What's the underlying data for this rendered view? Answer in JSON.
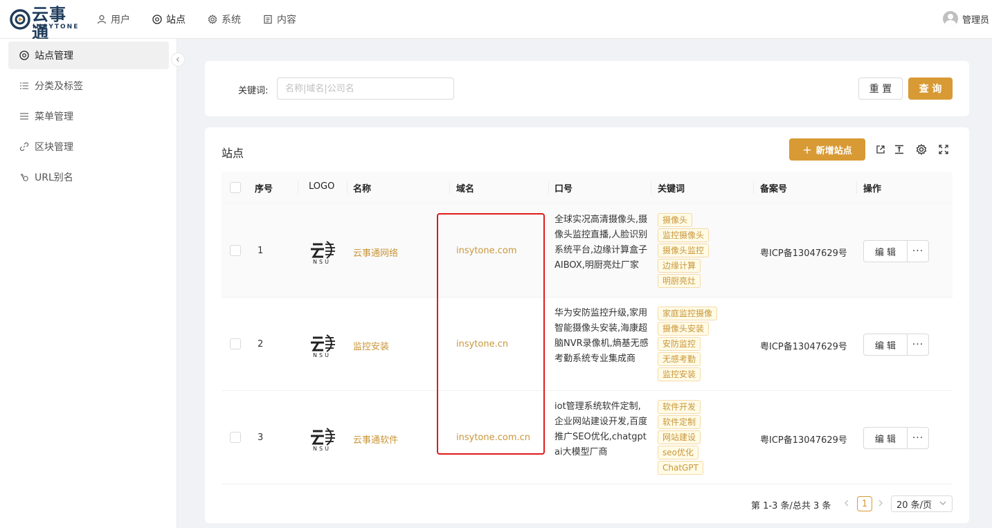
{
  "app": {
    "logo_cn": "云事通",
    "logo_en": "INSYTONE"
  },
  "topnav": [
    {
      "label": "用户",
      "icon": "user-icon"
    },
    {
      "label": "站点",
      "icon": "chrome-icon"
    },
    {
      "label": "系统",
      "icon": "gear-icon"
    },
    {
      "label": "内容",
      "icon": "document-icon"
    }
  ],
  "user": {
    "name": "管理员"
  },
  "sidebar": {
    "items": [
      {
        "label": "站点管理",
        "icon": "chrome-icon"
      },
      {
        "label": "分类及标签",
        "icon": "list-icon"
      },
      {
        "label": "菜单管理",
        "icon": "menu-icon"
      },
      {
        "label": "区块管理",
        "icon": "link-icon"
      },
      {
        "label": "URL别名",
        "icon": "url-icon"
      }
    ]
  },
  "search": {
    "label": "关键词:",
    "placeholder": "名称|域名|公司名",
    "value": "",
    "reset_label": "重 置",
    "query_label": "查 询"
  },
  "table": {
    "title": "站点",
    "add_label": "新增站点",
    "columns": [
      "序号",
      "LOGO",
      "名称",
      "域名",
      "口号",
      "关键词",
      "备案号",
      "操作"
    ],
    "edit_label": "编 辑",
    "more_label": "···",
    "rows": [
      {
        "seq": "1",
        "name": "云事通网络",
        "domain": "insytone.com",
        "slogan": "全球实况高清摄像头,摄像头监控直播,人脸识别系统平台,边缘计算盒子AIBOX,明厨亮灶厂家",
        "tags": [
          "摄像头",
          "监控摄像头",
          "摄像头监控",
          "边缘计算",
          "明厨亮灶"
        ],
        "icp": "粤ICP备13047629号"
      },
      {
        "seq": "2",
        "name": "监控安装",
        "domain": "insytone.cn",
        "slogan": "华为安防监控升级,家用智能摄像头安装,海康超脑NVR录像机,熵基无感考勤系统专业集成商",
        "tags": [
          "家庭监控摄像",
          "摄像头安装",
          "安防监控",
          "无感考勤",
          "监控安装"
        ],
        "icp": "粤ICP备13047629号"
      },
      {
        "seq": "3",
        "name": "云事通软件",
        "domain": "insytone.com.cn",
        "slogan": "iot管理系统软件定制,企业网站建设开发,百度推广SEO优化,chatgpt ai大模型厂商",
        "tags": [
          "软件开发",
          "软件定制",
          "网站建设",
          "seo优化",
          "ChatGPT"
        ],
        "icp": "粤ICP备13047629号"
      }
    ]
  },
  "pagination": {
    "total_text": "第 1-3 条/总共 3 条",
    "current_page": "1",
    "page_size": "20 条/页"
  },
  "colors": {
    "accent": "#d89a34",
    "link": "#c9963a",
    "highlight": "#e0191b"
  }
}
